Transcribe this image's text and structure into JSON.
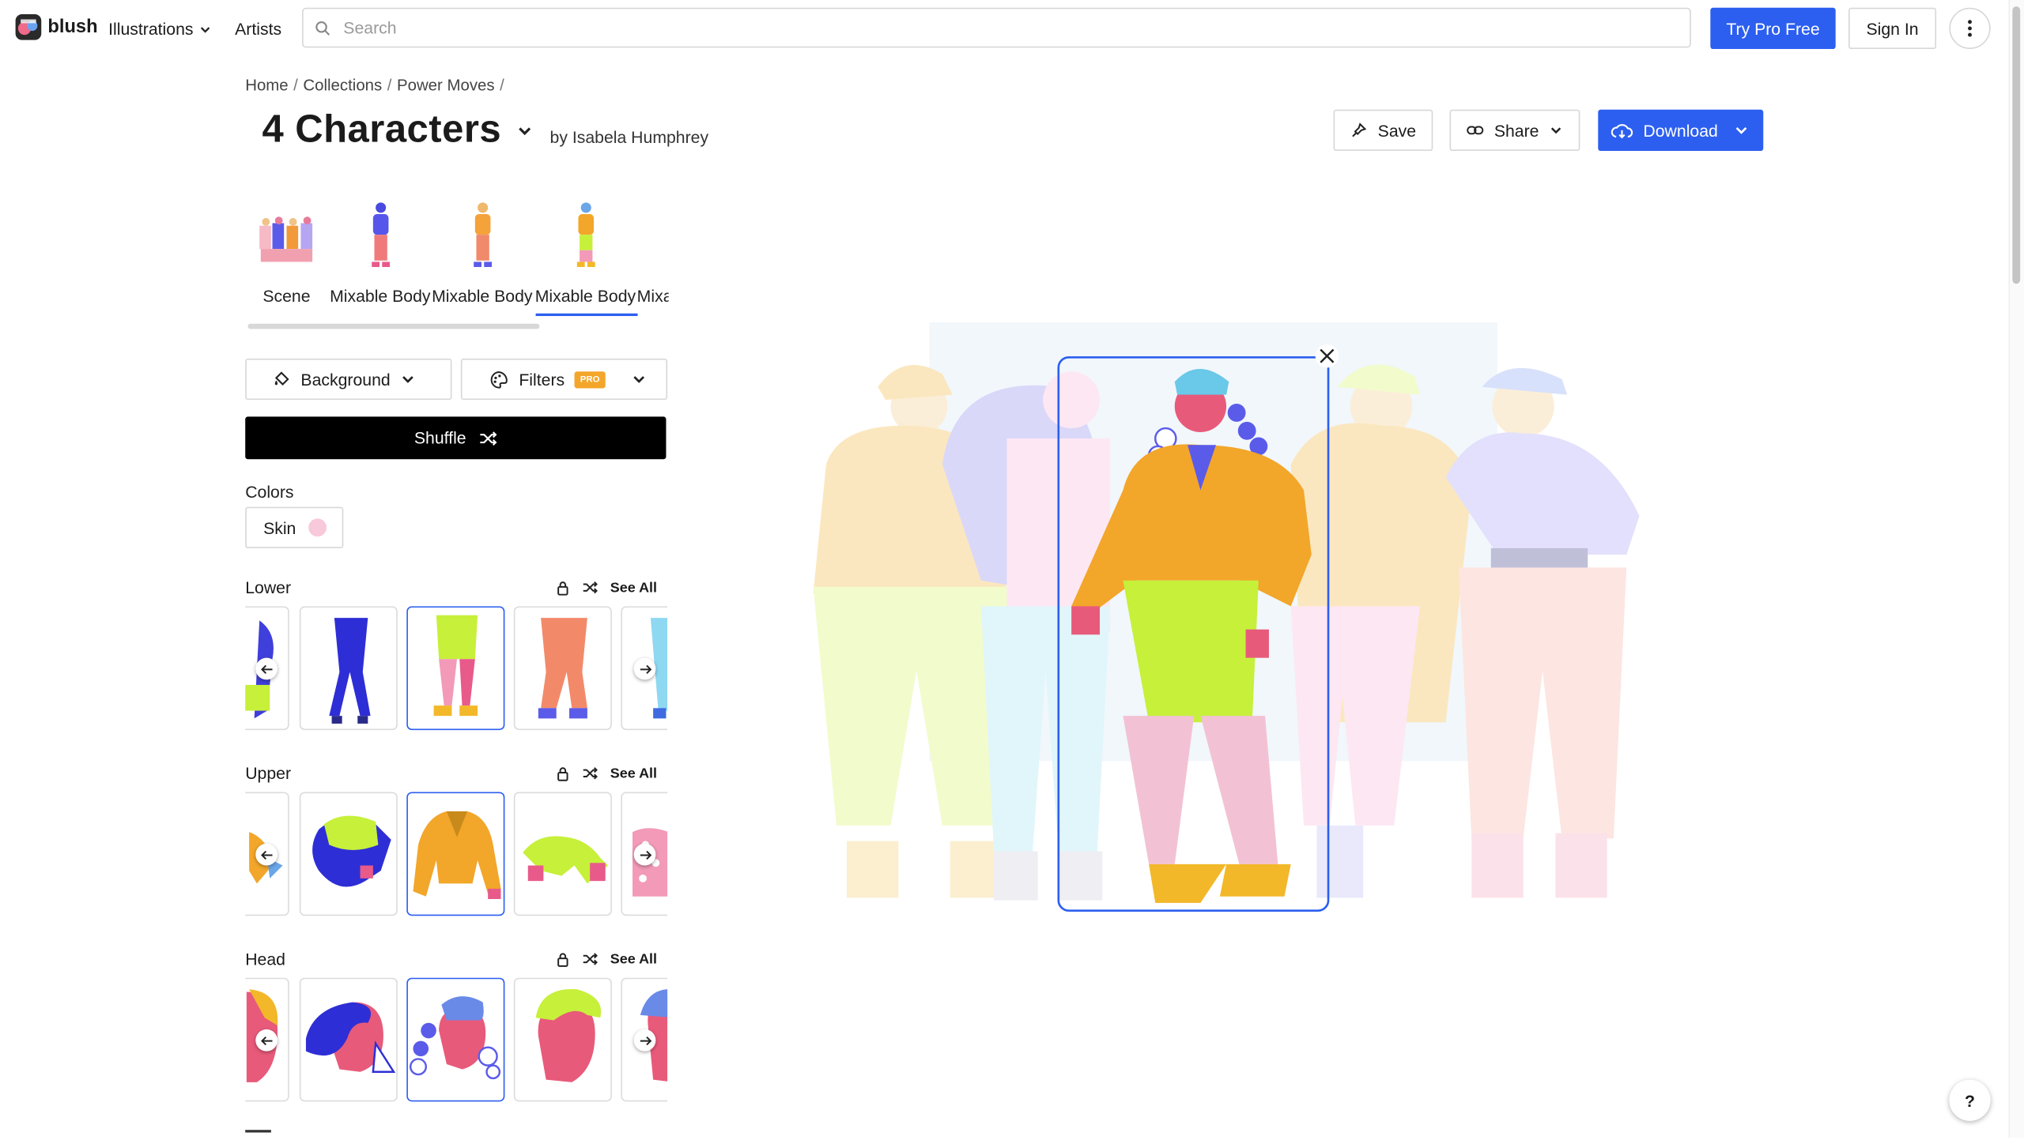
{
  "topbar": {
    "brand": "blush",
    "nav_illustrations": "Illustrations",
    "nav_artists": "Artists",
    "search_placeholder": "Search",
    "try_pro": "Try Pro Free",
    "sign_in": "Sign In"
  },
  "breadcrumb": {
    "items": [
      "Home",
      "Collections",
      "Power Moves"
    ]
  },
  "header": {
    "title": "4 Characters",
    "byline": "by Isabela Humphrey",
    "save": "Save",
    "share": "Share",
    "download": "Download"
  },
  "tabs": [
    {
      "label": "Scene"
    },
    {
      "label": "Mixable Body"
    },
    {
      "label": "Mixable Body"
    },
    {
      "label": "Mixable Body"
    },
    {
      "label": "Mixable Body"
    }
  ],
  "controls": {
    "background": "Background",
    "filters": "Filters",
    "pro_badge": "PRO",
    "shuffle": "Shuffle"
  },
  "colors": {
    "label": "Colors",
    "skin": "Skin",
    "skin_color": "#f8c9da"
  },
  "parts": {
    "lower": {
      "label": "Lower",
      "see_all": "See All"
    },
    "upper": {
      "label": "Upper",
      "see_all": "See All"
    },
    "head": {
      "label": "Head",
      "see_all": "See All"
    }
  },
  "help": "?",
  "accent": "#2c5ff0"
}
